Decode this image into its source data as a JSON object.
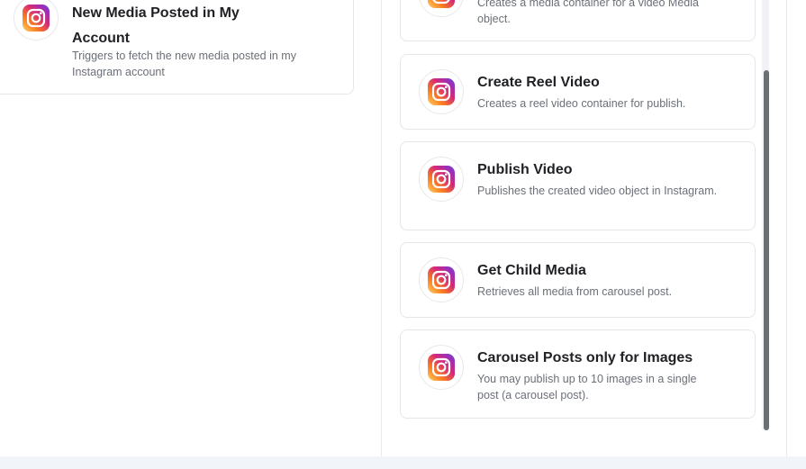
{
  "trigger": {
    "title": "New Media Posted in My Account",
    "description": "Triggers to fetch the new media posted in my Instagram account",
    "icon": "instagram-icon"
  },
  "actions": [
    {
      "title": "",
      "description": "Creates a media container for a video Media object.",
      "icon": "instagram-icon"
    },
    {
      "title": "Create Reel Video",
      "description": "Creates a reel video container for publish.",
      "icon": "instagram-icon"
    },
    {
      "title": "Publish Video",
      "description": "Publishes the created video object in Instagram.",
      "icon": "instagram-icon"
    },
    {
      "title": "Get Child Media",
      "description": "Retrieves all media from carousel post.",
      "icon": "instagram-icon"
    },
    {
      "title": "Carousel Posts only for Images",
      "description": "You may publish up to 10 images in a single post (a carousel post).",
      "icon": "instagram-icon"
    }
  ],
  "colors": {
    "instagram_gradient": [
      "#feda75",
      "#fa7e1e",
      "#d62976",
      "#962fbf",
      "#4f5bd5"
    ],
    "card_border": "#e4e6ea",
    "scroll_thumb": "#6b6e72",
    "bottom_strip": "#f1f4f8"
  }
}
